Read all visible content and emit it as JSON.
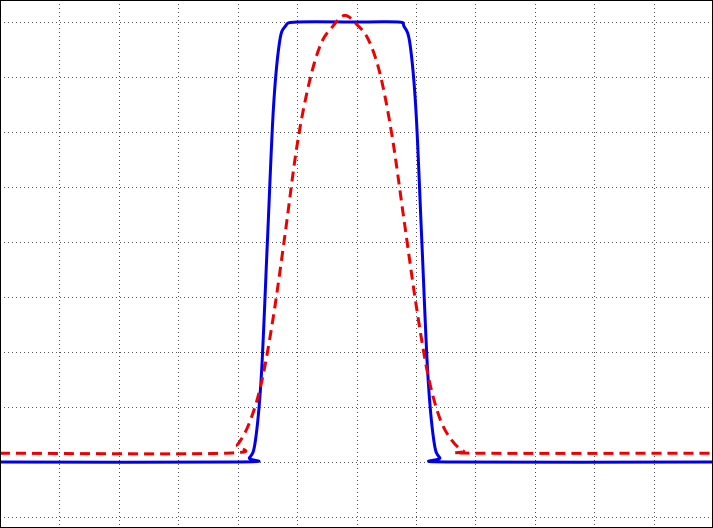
{
  "chart_data": {
    "type": "line",
    "title": "",
    "xlabel": "",
    "ylabel": "",
    "xlim": [
      -6,
      6
    ],
    "ylim": [
      -0.15,
      1.05
    ],
    "grid": true,
    "xgrid_step": 1,
    "ygrid_step": 0.125,
    "series": [
      {
        "style": "solid",
        "color": "#0000ee",
        "points": [
          [
            -6.0,
            0.0
          ],
          [
            -2.0,
            0.0
          ],
          [
            -1.8,
            0.01
          ],
          [
            -1.7,
            0.05
          ],
          [
            -1.6,
            0.2
          ],
          [
            -1.5,
            0.5
          ],
          [
            -1.4,
            0.8
          ],
          [
            -1.3,
            0.95
          ],
          [
            -1.2,
            0.99
          ],
          [
            -1.0,
            1.0
          ],
          [
            0.0,
            1.0
          ],
          [
            0.7,
            1.0
          ],
          [
            0.8,
            0.99
          ],
          [
            0.9,
            0.95
          ],
          [
            1.0,
            0.8
          ],
          [
            1.1,
            0.5
          ],
          [
            1.2,
            0.2
          ],
          [
            1.3,
            0.05
          ],
          [
            1.4,
            0.01
          ],
          [
            1.6,
            0.0
          ],
          [
            6.0,
            0.0
          ]
        ]
      },
      {
        "style": "dashed",
        "color": "#ee0000",
        "points": [
          [
            -6.0,
            0.02
          ],
          [
            -2.2,
            0.02
          ],
          [
            -2.0,
            0.04
          ],
          [
            -1.8,
            0.09
          ],
          [
            -1.6,
            0.18
          ],
          [
            -1.4,
            0.33
          ],
          [
            -1.2,
            0.52
          ],
          [
            -1.0,
            0.72
          ],
          [
            -0.8,
            0.86
          ],
          [
            -0.6,
            0.95
          ],
          [
            -0.4,
            0.99
          ],
          [
            -0.2,
            1.015
          ],
          [
            0.0,
            0.995
          ],
          [
            0.2,
            0.96
          ],
          [
            0.4,
            0.88
          ],
          [
            0.6,
            0.74
          ],
          [
            0.8,
            0.55
          ],
          [
            1.0,
            0.36
          ],
          [
            1.2,
            0.2
          ],
          [
            1.4,
            0.1
          ],
          [
            1.6,
            0.05
          ],
          [
            1.8,
            0.025
          ],
          [
            2.0,
            0.02
          ],
          [
            6.0,
            0.02
          ]
        ]
      }
    ]
  }
}
